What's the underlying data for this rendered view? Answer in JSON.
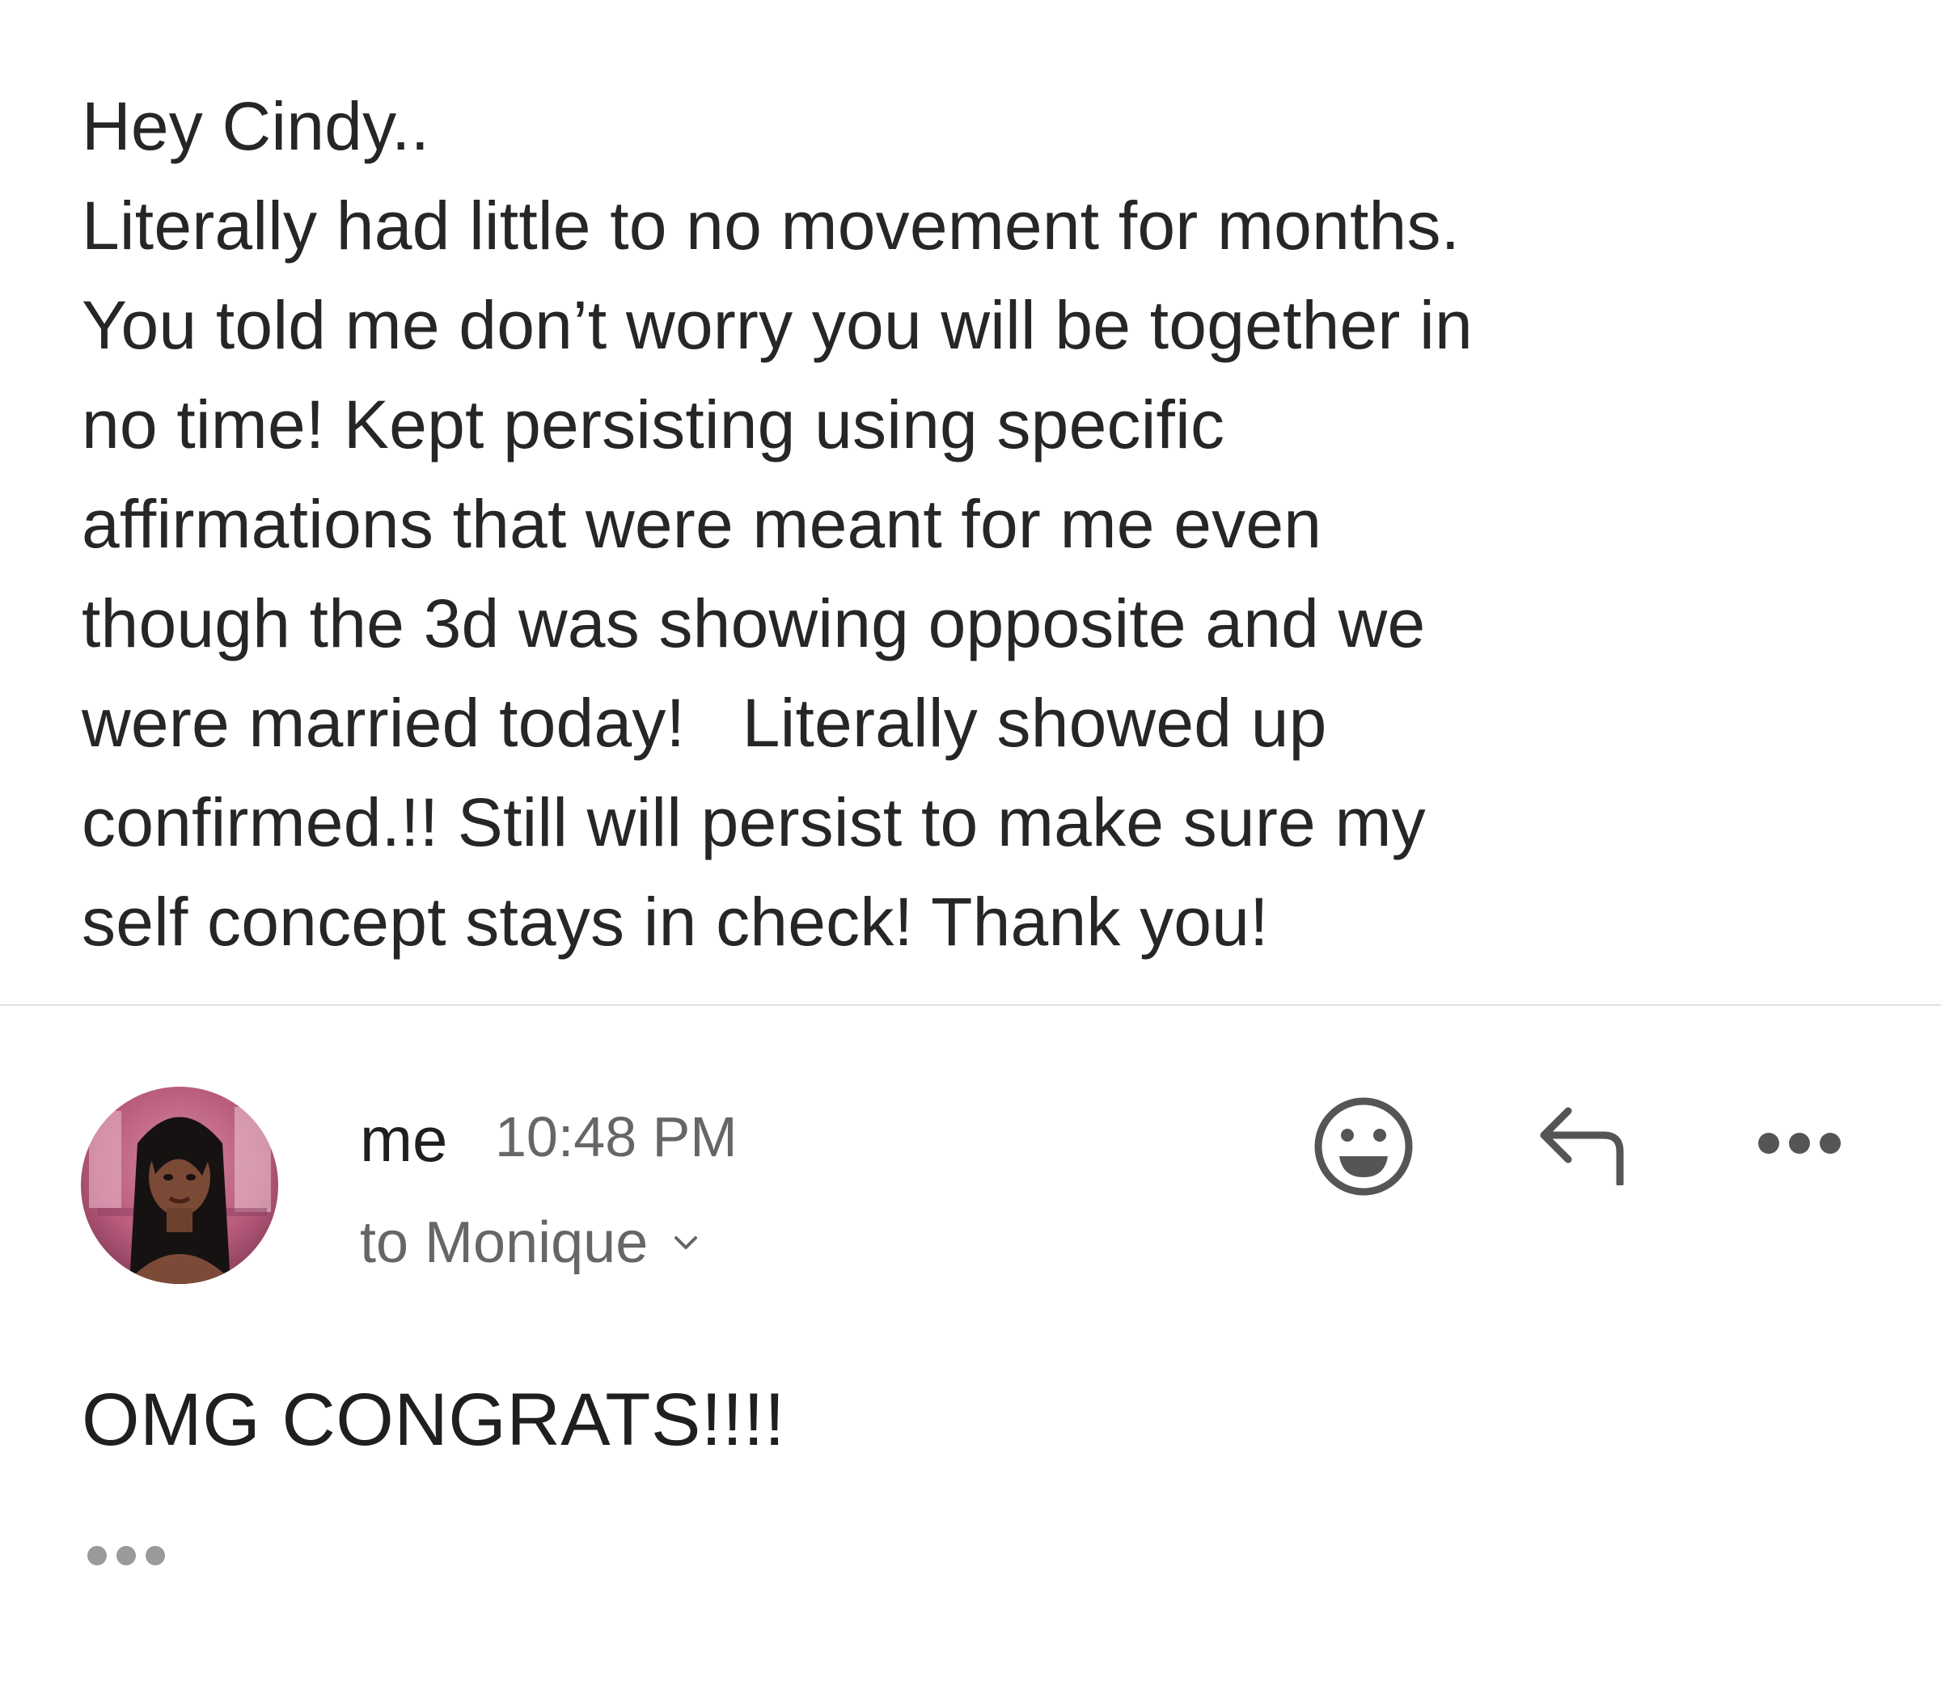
{
  "previous_message": {
    "lines": [
      "Hey Cindy..",
      "Literally had little to no movement for months.",
      "You told me don’t worry you will be together in",
      "no time! Kept persisting using specific",
      "affirmations that were meant for me even",
      "though the 3d was showing opposite and we",
      "were married today!   Literally showed up",
      "confirmed.!! Still will persist to make sure my",
      "self concept stays in check! Thank you!"
    ]
  },
  "reply": {
    "sender": "me",
    "time": "10:48 PM",
    "recipients": "to Monique",
    "body": "OMG CONGRATS!!!!"
  },
  "icons": {
    "emoji": "smiley-icon",
    "reply": "reply-arrow-icon",
    "more": "more-horizontal-icon",
    "recipients_toggle": "chevron-down-icon",
    "trimmed_content": "ellipsis-icon"
  },
  "colors": {
    "text": "#222222",
    "secondary_text": "#666666",
    "icon": "#555555",
    "divider": "#e0e0e0"
  }
}
